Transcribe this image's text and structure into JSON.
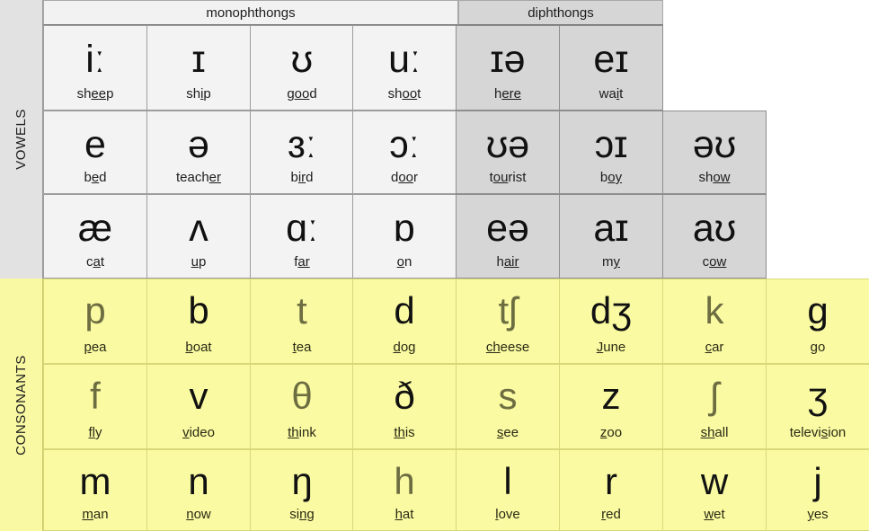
{
  "sidebar": {
    "vowels_label": "VOWELS",
    "consonants_label": "CONSONANTS",
    "vowels_color": "#e2e2e2",
    "consonants_color": "#f9f9a4"
  },
  "headers": {
    "monophthongs": "monophthongs",
    "diphthongs": "diphthongs"
  },
  "colors": {
    "monophthong_bg": "#f3f3f3",
    "diphthong_bg": "#d6d6d6",
    "consonant_bg": "#fafaa2",
    "voiceless_symbol": "#6d6d42",
    "voiced_symbol": "#111111"
  },
  "vowels": {
    "rows": [
      [
        {
          "symbol": "iː",
          "word": "sheep",
          "pre": "sh",
          "mark": "ee",
          "post": "p",
          "group": "mono"
        },
        {
          "symbol": "ɪ",
          "word": "ship",
          "pre": "sh",
          "mark": "i",
          "post": "p",
          "group": "mono"
        },
        {
          "symbol": "ʊ",
          "word": "good",
          "pre": "g",
          "mark": "oo",
          "post": "d",
          "group": "mono"
        },
        {
          "symbol": "uː",
          "word": "shoot",
          "pre": "sh",
          "mark": "oo",
          "post": "t",
          "group": "mono"
        },
        {
          "symbol": "ɪə",
          "word": "here",
          "pre": "h",
          "mark": "ere",
          "post": "",
          "group": "diph"
        },
        {
          "symbol": "eɪ",
          "word": "wait",
          "pre": "wa",
          "mark": "i",
          "post": "t",
          "group": "diph"
        }
      ],
      [
        {
          "symbol": "e",
          "word": "bed",
          "pre": "b",
          "mark": "e",
          "post": "d",
          "group": "mono"
        },
        {
          "symbol": "ə",
          "word": "teacher",
          "pre": "teach",
          "mark": "er",
          "post": "",
          "group": "mono"
        },
        {
          "symbol": "ɜː",
          "word": "bird",
          "pre": "b",
          "mark": "ir",
          "post": "d",
          "group": "mono"
        },
        {
          "symbol": "ɔː",
          "word": "door",
          "pre": "d",
          "mark": "oo",
          "post": "r",
          "group": "mono"
        },
        {
          "symbol": "ʊə",
          "word": "tourist",
          "pre": "t",
          "mark": "ou",
          "post": "rist",
          "group": "diph"
        },
        {
          "symbol": "ɔɪ",
          "word": "boy",
          "pre": "b",
          "mark": "oy",
          "post": "",
          "group": "diph"
        },
        {
          "symbol": "əʊ",
          "word": "show",
          "pre": "sh",
          "mark": "ow",
          "post": "",
          "group": "diph"
        }
      ],
      [
        {
          "symbol": "æ",
          "word": "cat",
          "pre": "c",
          "mark": "a",
          "post": "t",
          "group": "mono"
        },
        {
          "symbol": "ʌ",
          "word": "up",
          "pre": "",
          "mark": "u",
          "post": "p",
          "group": "mono"
        },
        {
          "symbol": "ɑː",
          "word": "far",
          "pre": "f",
          "mark": "ar",
          "post": "",
          "group": "mono"
        },
        {
          "symbol": "ɒ",
          "word": "on",
          "pre": "",
          "mark": "o",
          "post": "n",
          "group": "mono"
        },
        {
          "symbol": "eə",
          "word": "hair",
          "pre": "h",
          "mark": "air",
          "post": "",
          "group": "diph"
        },
        {
          "symbol": "aɪ",
          "word": "my",
          "pre": "m",
          "mark": "y",
          "post": "",
          "group": "diph"
        },
        {
          "symbol": "aʊ",
          "word": "cow",
          "pre": "c",
          "mark": "ow",
          "post": "",
          "group": "diph"
        }
      ]
    ]
  },
  "consonants": {
    "rows": [
      [
        {
          "symbol": "p",
          "word": "pea",
          "pre": "",
          "mark": "p",
          "post": "ea",
          "voiced": false
        },
        {
          "symbol": "b",
          "word": "boat",
          "pre": "",
          "mark": "b",
          "post": "oat",
          "voiced": true
        },
        {
          "symbol": "t",
          "word": "tea",
          "pre": "",
          "mark": "t",
          "post": "ea",
          "voiced": false
        },
        {
          "symbol": "d",
          "word": "dog",
          "pre": "",
          "mark": "d",
          "post": "og",
          "voiced": true
        },
        {
          "symbol": "tʃ",
          "word": "cheese",
          "pre": "",
          "mark": "ch",
          "post": "eese",
          "voiced": false
        },
        {
          "symbol": "dʒ",
          "word": "June",
          "pre": "",
          "mark": "J",
          "post": "une",
          "voiced": true
        },
        {
          "symbol": "k",
          "word": "car",
          "pre": "",
          "mark": "c",
          "post": "ar",
          "voiced": false
        },
        {
          "symbol": "g",
          "word": "go",
          "pre": "",
          "mark": "g",
          "post": "o",
          "voiced": true
        }
      ],
      [
        {
          "symbol": "f",
          "word": "fly",
          "pre": "",
          "mark": "fl",
          "post": "y",
          "voiced": false
        },
        {
          "symbol": "v",
          "word": "video",
          "pre": "",
          "mark": "v",
          "post": "ideo",
          "voiced": true
        },
        {
          "symbol": "θ",
          "word": "think",
          "pre": "",
          "mark": "th",
          "post": "ink",
          "voiced": false
        },
        {
          "symbol": "ð",
          "word": "this",
          "pre": "",
          "mark": "th",
          "post": "is",
          "voiced": true
        },
        {
          "symbol": "s",
          "word": "see",
          "pre": "",
          "mark": "s",
          "post": "ee",
          "voiced": false
        },
        {
          "symbol": "z",
          "word": "zoo",
          "pre": "",
          "mark": "z",
          "post": "oo",
          "voiced": true
        },
        {
          "symbol": "ʃ",
          "word": "shall",
          "pre": "",
          "mark": "sh",
          "post": "all",
          "voiced": false
        },
        {
          "symbol": "ʒ",
          "word": "television",
          "pre": "televi",
          "mark": "s",
          "post": "ion",
          "voiced": true
        }
      ],
      [
        {
          "symbol": "m",
          "word": "man",
          "pre": "",
          "mark": "m",
          "post": "an",
          "voiced": true
        },
        {
          "symbol": "n",
          "word": "now",
          "pre": "",
          "mark": "n",
          "post": "ow",
          "voiced": true
        },
        {
          "symbol": "ŋ",
          "word": "sing",
          "pre": "si",
          "mark": "ng",
          "post": "",
          "voiced": true
        },
        {
          "symbol": "h",
          "word": "hat",
          "pre": "",
          "mark": "h",
          "post": "at",
          "voiced": false
        },
        {
          "symbol": "l",
          "word": "love",
          "pre": "",
          "mark": "l",
          "post": "ove",
          "voiced": true
        },
        {
          "symbol": "r",
          "word": "red",
          "pre": "",
          "mark": "r",
          "post": "ed",
          "voiced": true
        },
        {
          "symbol": "w",
          "word": "wet",
          "pre": "",
          "mark": "w",
          "post": "et",
          "voiced": true
        },
        {
          "symbol": "j",
          "word": "yes",
          "pre": "",
          "mark": "y",
          "post": "es",
          "voiced": true
        }
      ]
    ]
  }
}
